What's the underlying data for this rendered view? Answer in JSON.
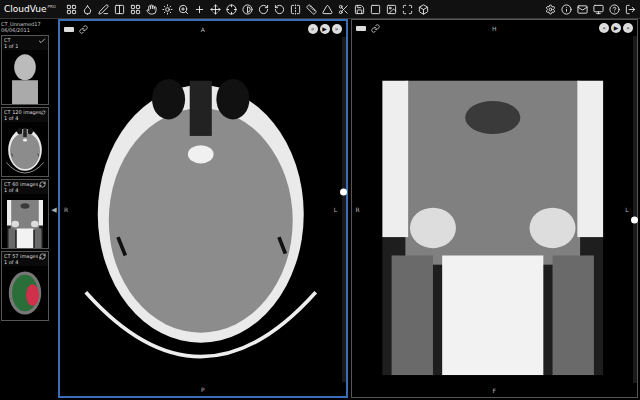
{
  "app": {
    "title": "CloudVue",
    "superscript": "PRO"
  },
  "sidebar": {
    "patient": [
      "CT_Unnamed17",
      "06/06/2011"
    ],
    "toggle": "◀",
    "series": [
      {
        "title": "CT",
        "count": "1 of 1",
        "loaded": true,
        "kind": "scout"
      },
      {
        "title": "CT 120 images",
        "count": "1 of 4",
        "loaded": false,
        "kind": "axial"
      },
      {
        "title": "CT 60 images",
        "count": "1 of 4",
        "loaded": false,
        "kind": "coronal"
      },
      {
        "title": "CT 57 images",
        "count": "1 of 4",
        "loaded": false,
        "kind": "colormap"
      }
    ]
  },
  "viewports": [
    {
      "selected": true,
      "kind": "axial",
      "top": "A",
      "bottom": "P",
      "left": "R",
      "right": "L",
      "scroll_level": 0.45,
      "controls": [
        "«",
        "▶",
        "»"
      ]
    },
    {
      "selected": false,
      "kind": "coronal",
      "top": "H",
      "bottom": "F",
      "left": "R",
      "right": "L",
      "scroll_level": 0.53,
      "controls": [
        "«",
        "▶",
        "»"
      ]
    }
  ]
}
